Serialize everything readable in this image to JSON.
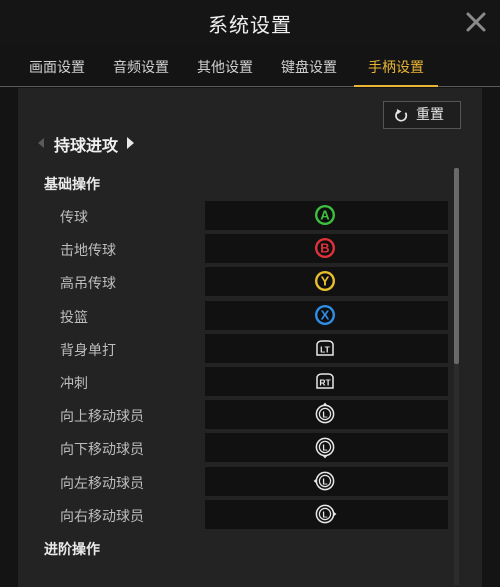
{
  "window": {
    "title": "系统设置"
  },
  "tabs": [
    {
      "label": "画面设置"
    },
    {
      "label": "音频设置"
    },
    {
      "label": "其他设置"
    },
    {
      "label": "键盘设置"
    },
    {
      "label": "手柄设置",
      "active": true
    }
  ],
  "reset_label": "重置",
  "section_title": "持球进攻",
  "groups": {
    "basic": "基础操作",
    "advanced": "进阶操作"
  },
  "bindings": [
    {
      "label": "传球",
      "button": "A",
      "icon": "a-button-icon",
      "color": "#3fbf3f"
    },
    {
      "label": "击地传球",
      "button": "B",
      "icon": "b-button-icon",
      "color": "#e0323a"
    },
    {
      "label": "高吊传球",
      "button": "Y",
      "icon": "y-button-icon",
      "color": "#e8c02e"
    },
    {
      "label": "投篮",
      "button": "X",
      "icon": "x-button-icon",
      "color": "#2f8fe6"
    },
    {
      "label": "背身单打",
      "button": "LT",
      "icon": "lt-trigger-icon"
    },
    {
      "label": "冲刺",
      "button": "RT",
      "icon": "rt-trigger-icon"
    },
    {
      "label": "向上移动球员",
      "button": "L",
      "direction": "up",
      "icon": "left-stick-up-icon"
    },
    {
      "label": "向下移动球员",
      "button": "L",
      "direction": "down",
      "icon": "left-stick-down-icon"
    },
    {
      "label": "向左移动球员",
      "button": "L",
      "direction": "left",
      "icon": "left-stick-left-icon"
    },
    {
      "label": "向右移动球员",
      "button": "L",
      "direction": "right",
      "icon": "left-stick-right-icon"
    }
  ],
  "colors": {
    "accent": "#e8b436",
    "panel": "#232323",
    "binding_box": "#111111"
  }
}
